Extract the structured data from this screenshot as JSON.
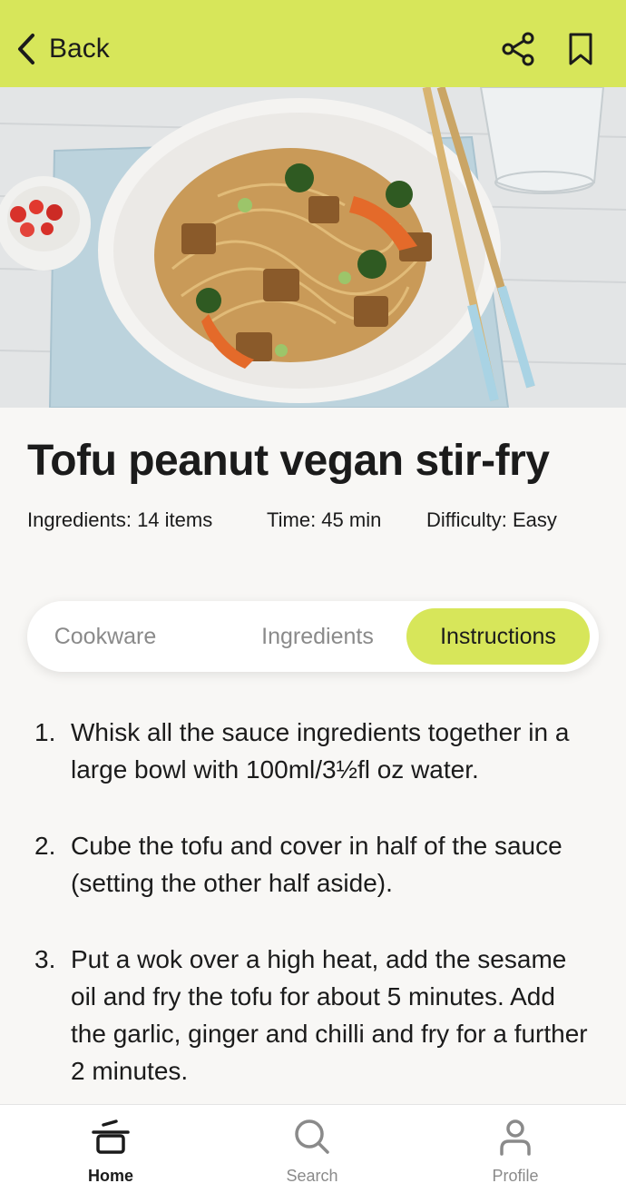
{
  "header": {
    "back_label": "Back",
    "accent_color": "#d7e65a",
    "icons": [
      "chevron-left-icon",
      "share-icon",
      "bookmark-icon"
    ]
  },
  "recipe": {
    "title": "Tofu peanut vegan stir-fry",
    "ingredients_meta": "Ingredients: 14 items",
    "time_meta": "Time: 45 min",
    "difficulty_meta": "Difficulty: Easy"
  },
  "tabs": [
    {
      "label": "Cookware",
      "active": false
    },
    {
      "label": "Ingredients",
      "active": false
    },
    {
      "label": "Instructions",
      "active": true
    }
  ],
  "instructions": [
    {
      "num": "1.",
      "text": "Whisk all the sauce ingredients together in a large bowl with 100ml/3½fl oz water."
    },
    {
      "num": "2.",
      "text": "Cube the tofu and cover in half of the sauce (setting the other half aside)."
    },
    {
      "num": "3.",
      "text": "Put a wok over a high heat, add the sesame oil and fry the tofu for about 5 minutes. Add the garlic, ginger and chilli and fry for a further 2 minutes."
    }
  ],
  "bottom_nav": [
    {
      "label": "Home",
      "icon": "pot-icon",
      "active": true
    },
    {
      "label": "Search",
      "icon": "search-icon",
      "active": false
    },
    {
      "label": "Profile",
      "icon": "user-icon",
      "active": false
    }
  ]
}
